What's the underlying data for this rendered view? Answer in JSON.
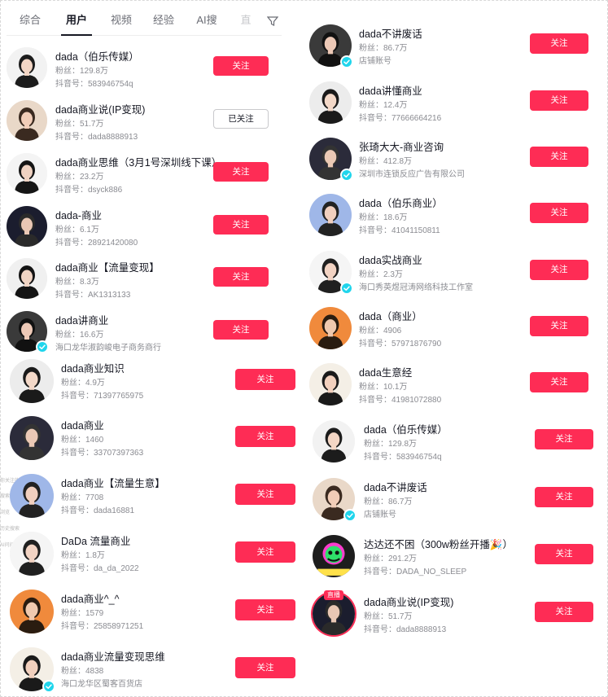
{
  "tabs": [
    "综合",
    "用户",
    "视频",
    "经验",
    "AI搜",
    "直"
  ],
  "active_tab": "用户",
  "accent_color": "#fe2c55",
  "verified_color": "#20d5ec",
  "left_list": [
    {
      "name": "dada（伯乐传媒）",
      "fans": "粉丝：129.8万",
      "sub": "抖音号：583946754q",
      "button": "关注",
      "followed": false,
      "verified": false
    },
    {
      "name": "dada商业说(IP变现)",
      "fans": "粉丝：51.7万",
      "sub": "抖音号：dada8888913",
      "button": "已关注",
      "followed": true,
      "verified": false
    },
    {
      "name": "dada商业思维（3月1号深圳线下课）",
      "fans": "粉丝：23.2万",
      "sub": "抖音号：dsyck886",
      "button": "关注",
      "followed": false,
      "verified": false
    },
    {
      "name": "dada-商业",
      "fans": "粉丝：6.1万",
      "sub": "抖音号：28921420080",
      "button": "关注",
      "followed": false,
      "verified": false
    },
    {
      "name": "dada商业【流量变现】",
      "fans": "粉丝：8.3万",
      "sub": "抖音号：AK1313133",
      "button": "关注",
      "followed": false,
      "verified": false
    },
    {
      "name": "dada讲商业",
      "fans": "粉丝：16.6万",
      "sub": "海口龙华淑韵峻电子商务商行",
      "button": "关注",
      "followed": false,
      "verified": true
    },
    {
      "name": "dada商业知识",
      "fans": "粉丝：4.9万",
      "sub": "抖音号：71397765975",
      "button": "关注",
      "followed": false,
      "verified": false
    },
    {
      "name": "dada商业",
      "fans": "粉丝：1460",
      "sub": "抖音号：33707397363",
      "button": "关注",
      "followed": false,
      "verified": false
    },
    {
      "name": "dada商业【流量生意】",
      "fans": "粉丝：7708",
      "sub": "抖音号：dada16881",
      "button": "关注",
      "followed": false,
      "verified": false
    },
    {
      "name": "DaDa 流量商业",
      "fans": "粉丝：1.8万",
      "sub": "抖音号：da_da_2022",
      "button": "关注",
      "followed": false,
      "verified": false
    },
    {
      "name": "dada商业^_^",
      "fans": "粉丝：1579",
      "sub": "抖音号：25858971251",
      "button": "关注",
      "followed": false,
      "verified": false
    },
    {
      "name": "dada商业流量变现思维",
      "fans": "粉丝：4838",
      "sub": "海口龙华区蜀客百货店",
      "button": "关注",
      "followed": false,
      "verified": true
    }
  ],
  "right_list": [
    {
      "name": "dada不讲废话",
      "fans": "粉丝：86.7万",
      "sub": "店铺账号",
      "button": "关注",
      "followed": false,
      "verified": true
    },
    {
      "name": "dada讲懂商业",
      "fans": "粉丝：12.4万",
      "sub": "抖音号：77666664216",
      "button": "关注",
      "followed": false,
      "verified": false
    },
    {
      "name": "张琦大大-商业咨询",
      "fans": "粉丝：412.8万",
      "sub": "深圳市连锁反应广告有限公司",
      "button": "关注",
      "followed": false,
      "verified": true
    },
    {
      "name": "dada（伯乐商业）",
      "fans": "粉丝：18.6万",
      "sub": "抖音号：41041150811",
      "button": "关注",
      "followed": false,
      "verified": false
    },
    {
      "name": "dada实战商业",
      "fans": "粉丝：2.3万",
      "sub": "海口秀英煜冠涛网络科技工作室",
      "button": "关注",
      "followed": false,
      "verified": true
    },
    {
      "name": "dada（商业）",
      "fans": "粉丝：4906",
      "sub": "抖音号：57971876790",
      "button": "关注",
      "followed": false,
      "verified": false
    },
    {
      "name": "dada生意经",
      "fans": "粉丝：10.1万",
      "sub": "抖音号：41981072880",
      "button": "关注",
      "followed": false,
      "verified": false
    },
    {
      "name": "dada（伯乐传媒）",
      "fans": "粉丝：129.8万",
      "sub": "抖音号：583946754q",
      "button": "关注",
      "followed": false,
      "verified": false
    },
    {
      "name": "dada不讲废话",
      "fans": "粉丝：86.7万",
      "sub": "店铺账号",
      "button": "关注",
      "followed": false,
      "verified": true
    },
    {
      "name": "达达还不困（300w粉丝开播🎉）",
      "fans": "粉丝：291.2万",
      "sub": "抖音号：DADA_NO_SLEEP",
      "button": "关注",
      "followed": false,
      "verified": false
    },
    {
      "name": "dada商业说(IP变现)",
      "fans": "粉丝：51.7万",
      "sub": "抖音号：dada8888913",
      "button": "关注",
      "followed": false,
      "verified": false,
      "live": true,
      "live_label": "直播"
    }
  ],
  "edge_labels": [
    "你关注的",
    "搜索记录",
    "浏览",
    "历史搜索",
    "AI问问"
  ]
}
